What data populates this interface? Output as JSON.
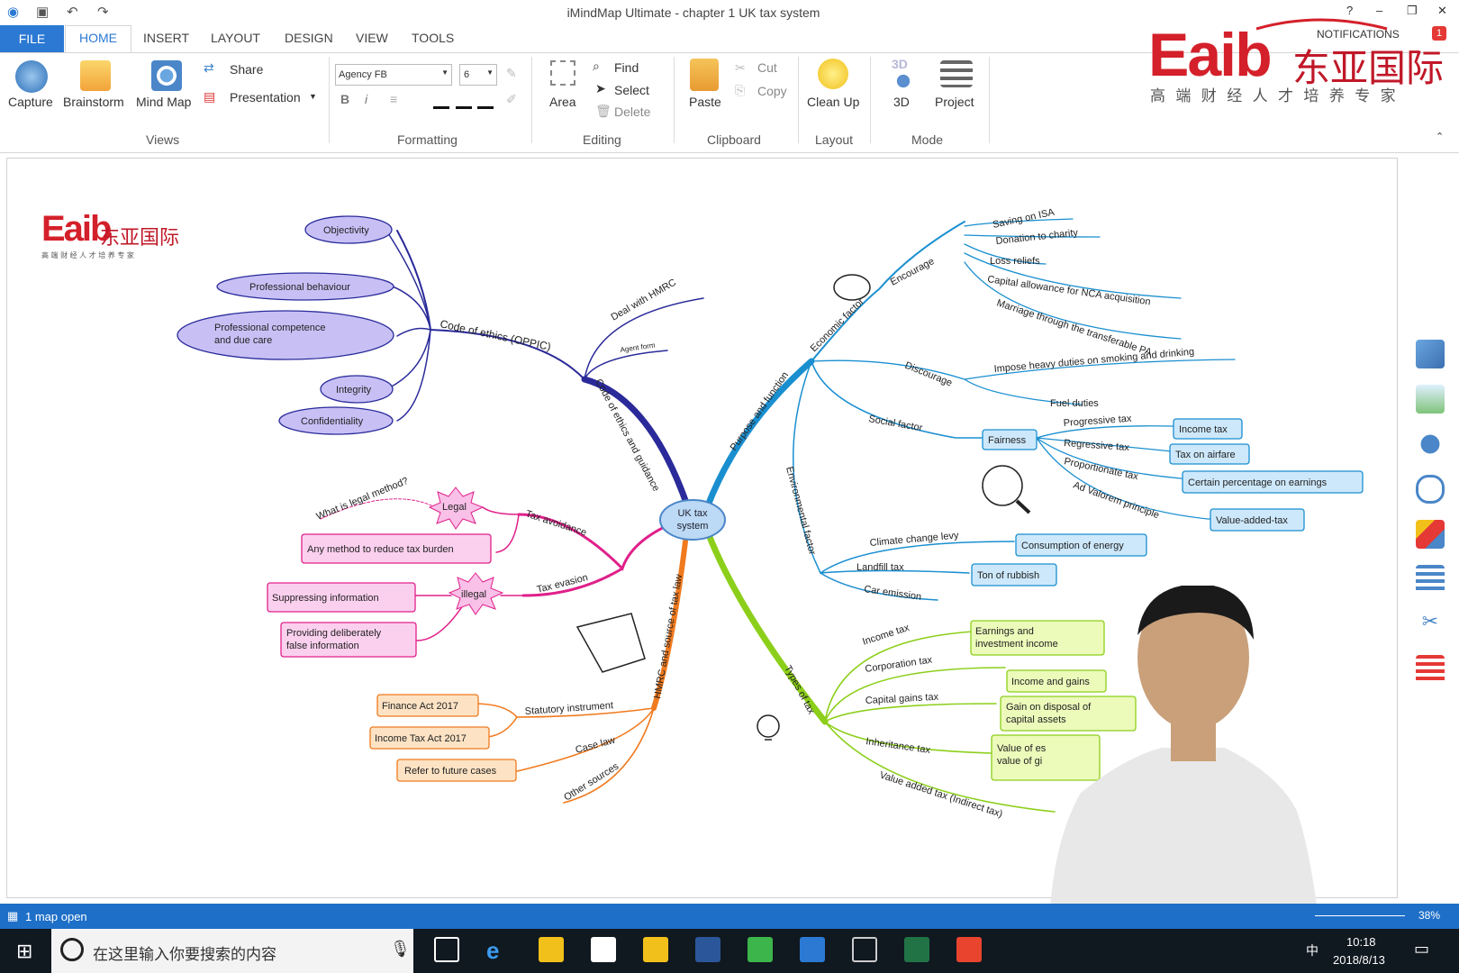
{
  "window": {
    "title": "iMindMap Ultimate - chapter 1 UK tax system",
    "help": "?",
    "minimize": "–",
    "restore": "❐",
    "close": "✕"
  },
  "tabs": [
    "FILE",
    "HOME",
    "INSERT",
    "LAYOUT",
    "DESIGN",
    "VIEW",
    "TOOLS"
  ],
  "ribbon": {
    "views": {
      "label": "Views",
      "capture": "Capture",
      "brainstorm": "Brainstorm",
      "mindmap": "Mind Map",
      "share": "Share",
      "presentation": "Presentation"
    },
    "formatting": {
      "label": "Formatting",
      "font": "Agency FB",
      "size": "6",
      "bold": "B",
      "italic": "i"
    },
    "editing": {
      "label": "Editing",
      "area": "Area",
      "find": "Find",
      "select": "Select",
      "delete": "Delete"
    },
    "clipboard": {
      "label": "Clipboard",
      "paste": "Paste",
      "cut": "Cut",
      "copy": "Copy"
    },
    "layout": {
      "label": "Layout",
      "cleanup": "Clean Up"
    },
    "mode": {
      "label": "Mode",
      "three_d": "3D",
      "project": "Project",
      "three_d_badge": "3D"
    }
  },
  "watermark": {
    "logo": "Eaib",
    "cn_name": "东亚国际",
    "slogan": "高 端 财 经 人 才 培 养 专 家",
    "notifications": "NOTIFICATIONS",
    "notif_count": "1"
  },
  "canvas_logo": {
    "logo": "Eaib",
    "cn_name": "东亚国际",
    "slogan": "高 端 财 经 人 才 培 养 专 家"
  },
  "mindmap": {
    "center": [
      "UK tax",
      "system"
    ],
    "ethics": {
      "branch": "Code of ethics and guidance",
      "sub": "Code of ethics (OPPIC)",
      "items": [
        "Objectivity",
        "Professional behaviour",
        "Professional competence",
        "and due care",
        "Integrity",
        "Confidentiality"
      ],
      "deal": "Deal with HMRC",
      "agent": "Agent form"
    },
    "avoid": {
      "legal": "Legal",
      "what": "What is legal method?",
      "avoidance": "Tax avoidance",
      "any": "Any method to reduce tax burden",
      "evasion": "Tax evasion",
      "illegal": "illegal",
      "suppress": "Suppressing information",
      "false1": "Providing deliberately",
      "false2": "false information"
    },
    "hmrc": {
      "branch": "HMRC and source of tax law",
      "statutory": "Statutory instrument",
      "fa": "Finance Act 2017",
      "ita": "Income Tax Act 2017",
      "caselaw": "Case law",
      "refer": "Refer to future cases",
      "other": "Other sources"
    },
    "purpose": {
      "branch": "Purpose and function",
      "econ": "Economic factor",
      "encourage": "Encourage",
      "isa": "Saving on ISA",
      "charity": "Donation to charity",
      "loss": "Loss reliefs",
      "capital": "Capital allowance for NCA acquisition",
      "marriage": "Marriage through the transferable PA",
      "discourage": "Discourage",
      "impose": "Impose heavy duties on smoking and drinking",
      "fuel": "Fuel duties",
      "social": "Social factor",
      "fairness": "Fairness",
      "progressive": "Progressive tax",
      "regressive": "Regressive tax",
      "proportionate": "Proportionate tax",
      "advalorem": "Ad Valorem principle",
      "incometax": "Income tax",
      "airfare": "Tax on airfare",
      "certain": "Certain percentage on earnings",
      "vat": "Value-added-tax",
      "env": "Environmental factor",
      "climate": "Climate change levy",
      "landfill": "Landfill tax",
      "car": "Car emission",
      "energy": "Consumption of energy",
      "rubbish": "Ton of rubbish"
    },
    "types": {
      "branch": "Types of tax",
      "income": "Income tax",
      "corp": "Corporation tax",
      "cgt": "Capital gains tax",
      "iht": "Inheritance tax",
      "vat": "Value added tax (Indirect tax)",
      "earnings1": "Earnings and",
      "earnings2": "investment income",
      "incgains": "Income and gains",
      "gain1": "Gain on disposal of",
      "gain2": "capital assets",
      "value1": "Value of es",
      "value2": "value of gi"
    }
  },
  "status": {
    "maps": "1 map open",
    "zoom": "38%"
  },
  "taskbar": {
    "search": "在这里输入你要搜索的内容",
    "time": "10:18",
    "date": "2018/8/13",
    "ime": "中"
  },
  "colors": {
    "file_tab": "#2b79d3",
    "status": "#1e6fc8",
    "ethics": "#2a2a9a",
    "purpose": "#1a8fd0",
    "types": "#8ccf1a",
    "hmrc": "#f07a1e",
    "avoid": "#e0208a",
    "eaib_red": "#d4202a"
  }
}
